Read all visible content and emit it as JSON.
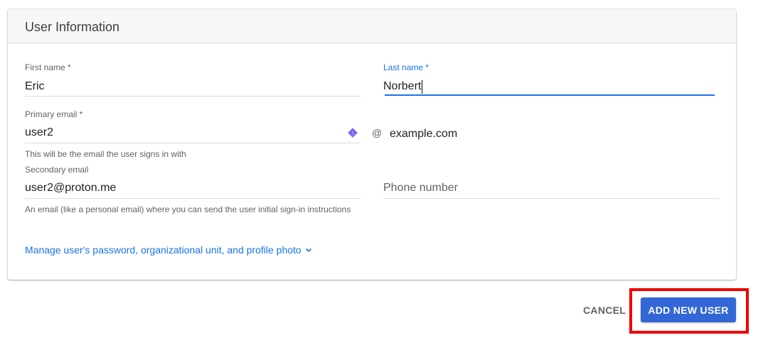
{
  "card": {
    "title": "User Information"
  },
  "form": {
    "first_name": {
      "label": "First name *",
      "value": "Eric"
    },
    "last_name": {
      "label": "Last name *",
      "value": "Norbert"
    },
    "primary_email": {
      "label": "Primary email *",
      "value": "user2",
      "at": "@",
      "domain": "example.com",
      "helper": "This will be the email the user signs in with"
    },
    "secondary_email": {
      "label": "Secondary email",
      "value": "user2@proton.me",
      "helper": "An email (like a personal email) where you can send the user initial sign-in instructions"
    },
    "phone": {
      "placeholder": "Phone number",
      "value": ""
    }
  },
  "manage_link": {
    "label": "Manage user's password, organizational unit, and profile photo",
    "icon": "chevron-down-icon"
  },
  "actions": {
    "cancel_label": "CANCEL",
    "add_label": "ADD NEW USER"
  },
  "colors": {
    "accent": "#1a73e8",
    "primary_button": "#3367d6",
    "highlight": "#ee0000"
  }
}
